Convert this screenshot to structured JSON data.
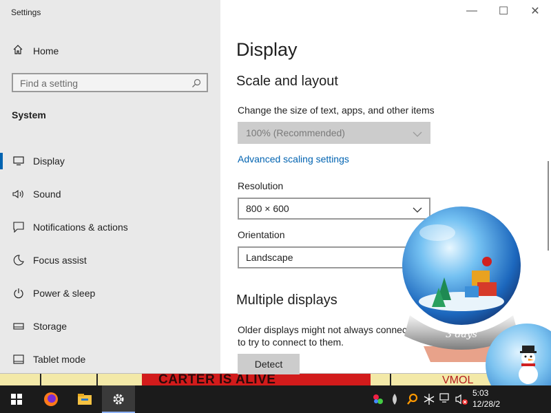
{
  "window": {
    "app_title": "Settings",
    "controls": {
      "minimize": "—",
      "maximize": "☐",
      "close": "✕"
    }
  },
  "sidebar": {
    "home_label": "Home",
    "search": {
      "placeholder": "Find a setting"
    },
    "section_title": "System",
    "items": [
      {
        "label": "Display",
        "icon": "display-icon",
        "selected": true
      },
      {
        "label": "Sound",
        "icon": "sound-icon"
      },
      {
        "label": "Notifications & actions",
        "icon": "notifications-icon"
      },
      {
        "label": "Focus assist",
        "icon": "focus-assist-icon"
      },
      {
        "label": "Power & sleep",
        "icon": "power-icon"
      },
      {
        "label": "Storage",
        "icon": "storage-icon"
      },
      {
        "label": "Tablet mode",
        "icon": "tablet-mode-icon"
      }
    ]
  },
  "main": {
    "page_title": "Display",
    "scale_section": {
      "heading": "Scale and layout",
      "scale_label": "Change the size of text, apps, and other items",
      "scale_value": "100% (Recommended)",
      "advanced_link": "Advanced scaling settings",
      "resolution_label": "Resolution",
      "resolution_value": "800 × 600",
      "orientation_label": "Orientation",
      "orientation_value": "Landscape"
    },
    "multiple_displays": {
      "heading": "Multiple displays",
      "description_line1": "Older displays might not always connect",
      "description_line2": "to try to connect to them.",
      "detect_button": "Detect"
    }
  },
  "desktop": {
    "banner_text": "CARTER IS ALIVE",
    "right_text": "VMOL"
  },
  "gadget": {
    "globe_label": "3 days"
  },
  "taskbar": {
    "apps": [
      "start-icon",
      "firefox-icon",
      "file-explorer-icon",
      "settings-icon"
    ],
    "clock_time": "5:03",
    "clock_date": "12/28/2"
  },
  "colors": {
    "accent": "#0063b1",
    "sidebar_bg": "#e9e9e9",
    "taskbar_bg": "#1b1b1b"
  }
}
